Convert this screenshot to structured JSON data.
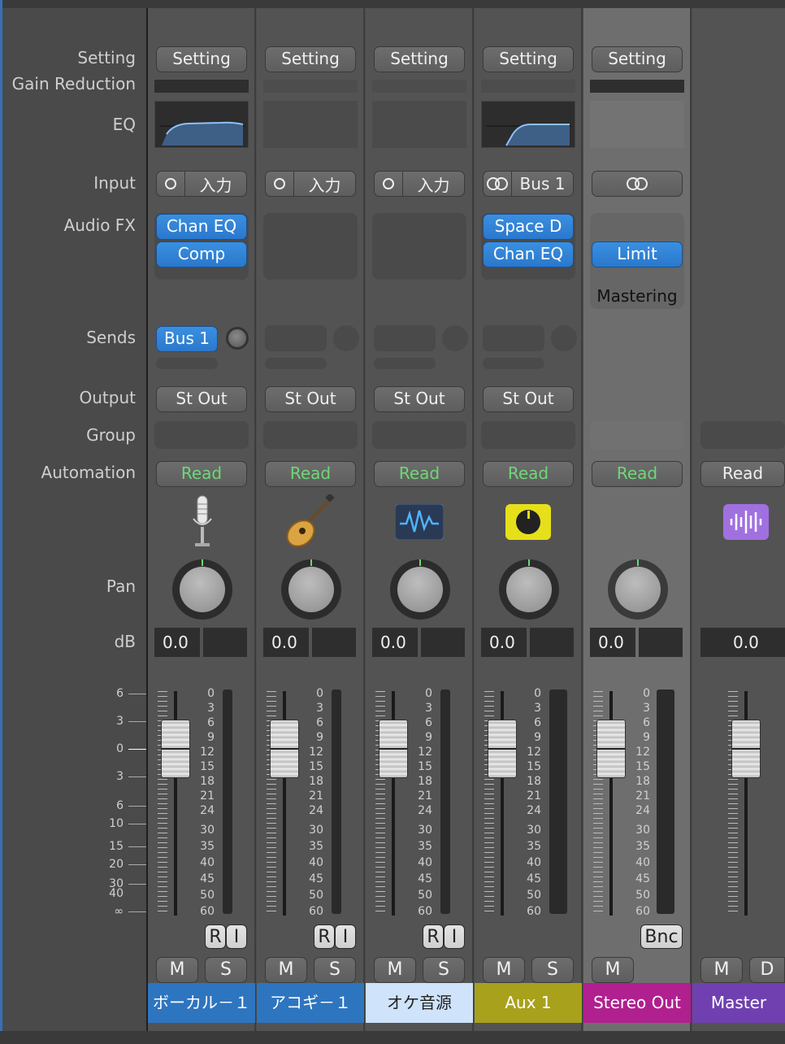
{
  "row_labels": {
    "setting": "Setting",
    "gain_reduction": "Gain Reduction",
    "eq": "EQ",
    "input": "Input",
    "audio_fx": "Audio FX",
    "sends": "Sends",
    "output": "Output",
    "group": "Group",
    "automation": "Automation",
    "pan": "Pan",
    "db": "dB"
  },
  "master_scale": [
    "6",
    "3",
    "0",
    "3",
    "6",
    "10",
    "15",
    "20",
    "30",
    "40",
    "∞"
  ],
  "meter_scale": [
    "0",
    "3",
    "6",
    "9",
    "12",
    "15",
    "18",
    "21",
    "24",
    "30",
    "35",
    "40",
    "45",
    "50",
    "60"
  ],
  "strips": [
    {
      "name": "ボーカル－１",
      "name_color": "#2e75c0",
      "setting": "Setting",
      "input": "入力",
      "audio_fx": [
        "Chan EQ",
        "Comp"
      ],
      "send": "Bus 1",
      "output": "St Out",
      "automation": "Read",
      "icon": "microphone-icon",
      "db": "0.0",
      "mute": "M",
      "solo": "S",
      "record": "R",
      "input_monitor": "I"
    },
    {
      "name": "アコギ－１",
      "name_color": "#2e75c0",
      "setting": "Setting",
      "input": "入力",
      "output": "St Out",
      "automation": "Read",
      "icon": "acoustic-guitar-icon",
      "db": "0.0",
      "mute": "M",
      "solo": "S",
      "record": "R",
      "input_monitor": "I"
    },
    {
      "name": "オケ音源",
      "name_color": "#cfe3fb",
      "setting": "Setting",
      "input": "入力",
      "output": "St Out",
      "automation": "Read",
      "icon": "waveform-icon",
      "db": "0.0",
      "mute": "M",
      "solo": "S",
      "record": "R",
      "input_monitor": "I"
    },
    {
      "name": "Aux 1",
      "name_color": "#a8a11c",
      "setting": "Setting",
      "input": "Bus 1",
      "audio_fx": [
        "Space D",
        "Chan EQ"
      ],
      "output": "St Out",
      "automation": "Read",
      "icon": "aux-knob-icon",
      "db": "0.0",
      "mute": "M",
      "solo": "S"
    },
    {
      "name": "Stereo Out",
      "name_color": "#b0208f",
      "setting": "Setting",
      "audio_fx": [
        "Limit"
      ],
      "fx_label": "Mastering",
      "automation": "Read",
      "db": "0.0",
      "mute": "M",
      "bounce": "Bnc"
    },
    {
      "name": "Master",
      "name_color": "#7040b0",
      "automation": "Read",
      "icon": "audio-file-icon",
      "db": "0.0",
      "mute": "M",
      "dim": "D"
    }
  ]
}
